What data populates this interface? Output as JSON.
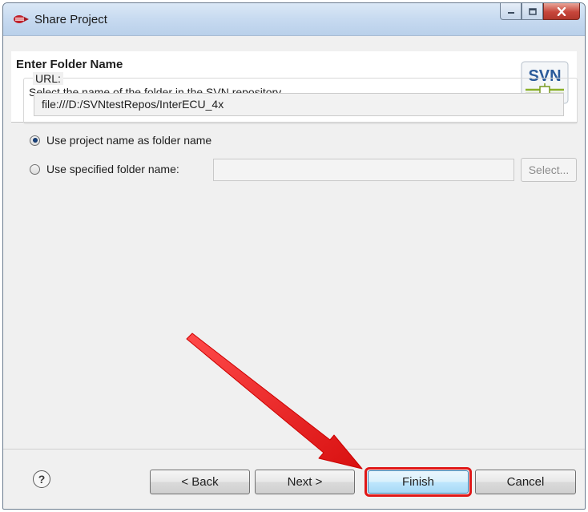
{
  "window": {
    "title": "Share Project"
  },
  "header": {
    "title": "Enter Folder Name",
    "description": "Select the name of the folder in the SVN repository.",
    "logo_text": "SVN"
  },
  "options": {
    "use_project_name_label": "Use project name as folder name",
    "use_project_name_selected": true,
    "use_specified_label": "Use specified folder name:",
    "use_specified_selected": false,
    "specified_value": "",
    "select_button_label": "Select..."
  },
  "url": {
    "label": "URL:",
    "value": "file:///D:/SVNtestRepos/InterECU_4x"
  },
  "buttons": {
    "help_label": "?",
    "back_label": "< Back",
    "next_label": "Next >",
    "finish_label": "Finish",
    "cancel_label": "Cancel"
  },
  "colors": {
    "annotation_red": "#e01818",
    "title_bar": "#c7daf0",
    "dialog_bg": "#f0f0f0"
  }
}
